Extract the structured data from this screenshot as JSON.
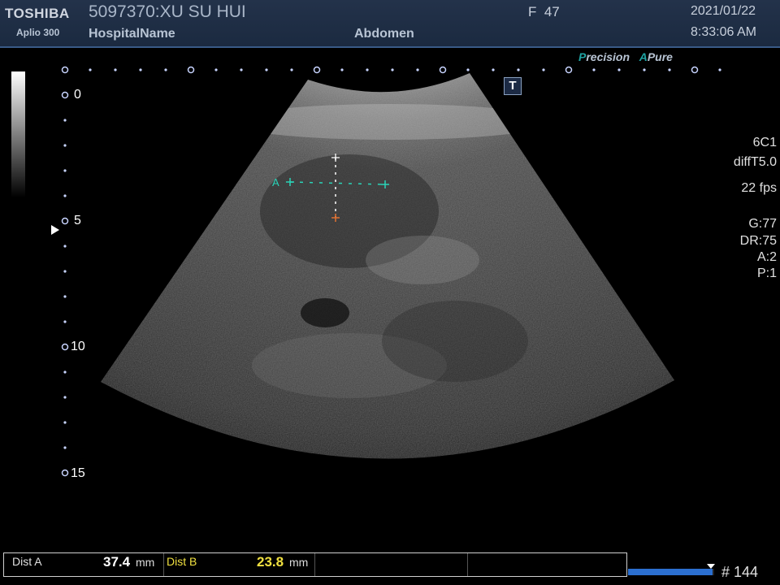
{
  "header": {
    "brand": "TOSHIBA",
    "model": "Aplio 300",
    "patient": "5097370:XU SU HUI",
    "hospital": "HospitalName",
    "sex_age": "F  47",
    "exam": "Abdomen",
    "date": "2021/01/22",
    "time": "8:33:06 AM"
  },
  "features": {
    "precision_letter": "P",
    "precision_rest": "recision",
    "apure_letter": "A",
    "apure_rest": "Pure"
  },
  "t_badge": "T",
  "params": {
    "probe": "6C1",
    "mode": "diffT5.0",
    "fps": "22 fps",
    "gain": "G:77",
    "dynamic_range": "DR:75",
    "a": "A:2",
    "p": "P:1"
  },
  "depth_labels": [
    "0",
    "5",
    "10",
    "15"
  ],
  "caliper_label": "A",
  "measurements": {
    "dist_a_label": "Dist A",
    "dist_a_value": "37.4",
    "dist_a_unit": "mm",
    "dist_b_label": "Dist B",
    "dist_b_value": "23.8",
    "dist_b_unit": "mm"
  },
  "cine": {
    "frame": "# 144",
    "progress_fraction": 0.98
  },
  "colors": {
    "header_bg": "#1b2a40",
    "accent": "#1fa3a3",
    "caliper_a": "#2ad4b8",
    "caliper_b": "#e07030",
    "value_a": "#ffffff",
    "value_b": "#f0e040",
    "progress": "#2b6fd0"
  }
}
